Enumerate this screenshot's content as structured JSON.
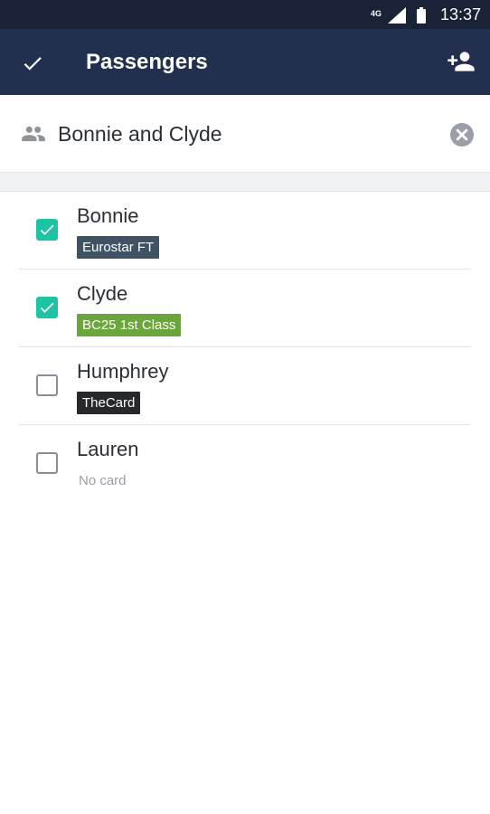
{
  "status_bar": {
    "network": "4G",
    "time": "13:37",
    "icons": [
      "signal-icon",
      "battery-icon"
    ]
  },
  "app_bar": {
    "title": "Passengers",
    "icons": [
      "check-icon",
      "add-person-icon"
    ]
  },
  "group": {
    "name": "Bonnie and Clyde",
    "icons": [
      "group-icon",
      "clear-icon"
    ]
  },
  "passengers": [
    {
      "name": "Bonnie",
      "selected": true,
      "card": "Eurostar FT",
      "card_color": "#3f5364"
    },
    {
      "name": "Clyde",
      "selected": true,
      "card": "BC25 1st Class",
      "card_color": "#6aa63a"
    },
    {
      "name": "Humphrey",
      "selected": false,
      "card": "TheCard",
      "card_color": "#26282b"
    },
    {
      "name": "Lauren",
      "selected": false,
      "card": null,
      "no_card_text": "No card"
    }
  ],
  "colors": {
    "status_bar": "#1a2238",
    "app_bar": "#232f4f",
    "accent_checkbox": "#1dc4a3"
  }
}
